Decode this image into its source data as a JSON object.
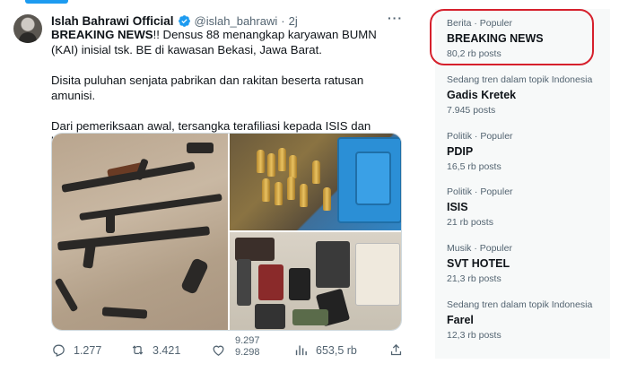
{
  "tweet": {
    "author_name": "Islah Bahrawi Official",
    "handle": "@islah_bahrawi",
    "separator": "·",
    "time": "2j",
    "more": "···",
    "paragraphs": [
      {
        "bold": "BREAKING NEWS",
        "text": "!! Densus 88 menangkap karyawan BUMN (KAI) inisial tsk. BE di kawasan Bekasi, Jawa Barat."
      },
      {
        "bold": "",
        "text": "Disita puluhan senjata pabrikan dan rakitan beserta ratusan amunisi."
      },
      {
        "bold": "",
        "text": "Dari pemeriksaan awal, tersangka terafiliasi kepada ISIS dan berniat melakukan amaliyah menjelang Pemilu."
      }
    ],
    "actions": {
      "replies": "1.277",
      "retweets": "3.421",
      "likes_top": "9.297",
      "likes_bottom": "9.298",
      "views": "653,5 rb"
    }
  },
  "trends": [
    {
      "meta": "Berita · Populer",
      "name": "BREAKING NEWS",
      "count": "80,2 rb posts"
    },
    {
      "meta": "Sedang tren dalam topik Indonesia",
      "name": "Gadis Kretek",
      "count": "7.945 posts"
    },
    {
      "meta": "Politik · Populer",
      "name": "PDIP",
      "count": "16,5 rb posts"
    },
    {
      "meta": "Politik · Populer",
      "name": "ISIS",
      "count": "21 rb posts"
    },
    {
      "meta": "Musik · Populer",
      "name": "SVT HOTEL",
      "count": "21,3 rb posts"
    },
    {
      "meta": "Sedang tren dalam topik Indonesia",
      "name": "Farel",
      "count": "12,3 rb posts"
    }
  ],
  "colors": {
    "accent": "#1d9bf0",
    "highlight_border": "#d6202c",
    "secondary_text": "#536471",
    "trends_bg": "#f7f9f9"
  },
  "icons": [
    "verified-badge-icon",
    "more-icon",
    "reply-icon",
    "retweet-icon",
    "like-icon",
    "views-icon",
    "share-icon"
  ]
}
